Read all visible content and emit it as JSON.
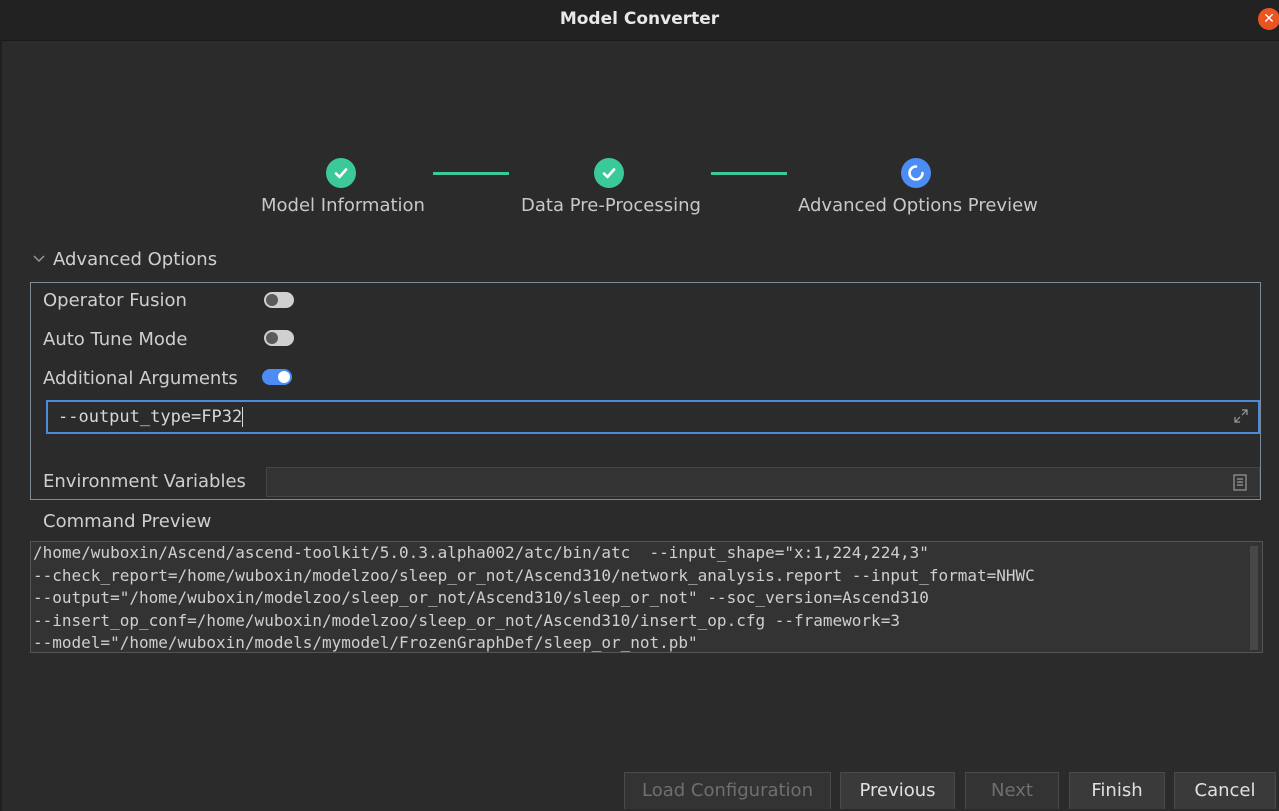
{
  "window": {
    "title": "Model Converter"
  },
  "stepper": {
    "steps": [
      {
        "label": "Model Information",
        "status": "complete"
      },
      {
        "label": "Data Pre-Processing",
        "status": "complete"
      },
      {
        "label": "Advanced Options  Preview",
        "status": "current"
      }
    ]
  },
  "advanced": {
    "section_title": "Advanced Options",
    "operator_fusion": {
      "label": "Operator Fusion",
      "enabled": false
    },
    "auto_tune": {
      "label": "Auto Tune Mode",
      "enabled": false
    },
    "additional_args": {
      "label": "Additional Arguments",
      "enabled": true,
      "value": "--output_type=FP32"
    },
    "env_vars": {
      "label": "Environment Variables",
      "value": ""
    }
  },
  "preview": {
    "label": "Command Preview",
    "lines": [
      "/home/wuboxin/Ascend/ascend-toolkit/5.0.3.alpha002/atc/bin/atc  --input_shape=\"x:1,224,224,3\"",
      "--check_report=/home/wuboxin/modelzoo/sleep_or_not/Ascend310/network_analysis.report --input_format=NHWC",
      "--output=\"/home/wuboxin/modelzoo/sleep_or_not/Ascend310/sleep_or_not\" --soc_version=Ascend310",
      "--insert_op_conf=/home/wuboxin/modelzoo/sleep_or_not/Ascend310/insert_op.cfg --framework=3",
      "--model=\"/home/wuboxin/models/mymodel/FrozenGraphDef/sleep_or_not.pb\""
    ]
  },
  "buttons": {
    "load_config": "Load Configuration",
    "previous": "Previous",
    "next": "Next",
    "finish": "Finish",
    "cancel": "Cancel"
  },
  "colors": {
    "accent_blue": "#4c8cf5",
    "complete_green": "#3cc99a",
    "close_orange": "#e95420"
  },
  "icons": {
    "close": "close-icon",
    "check": "check-icon",
    "spinner": "progress-icon",
    "chevron": "chevron-down-icon",
    "expand": "expand-icon",
    "document": "document-icon"
  }
}
